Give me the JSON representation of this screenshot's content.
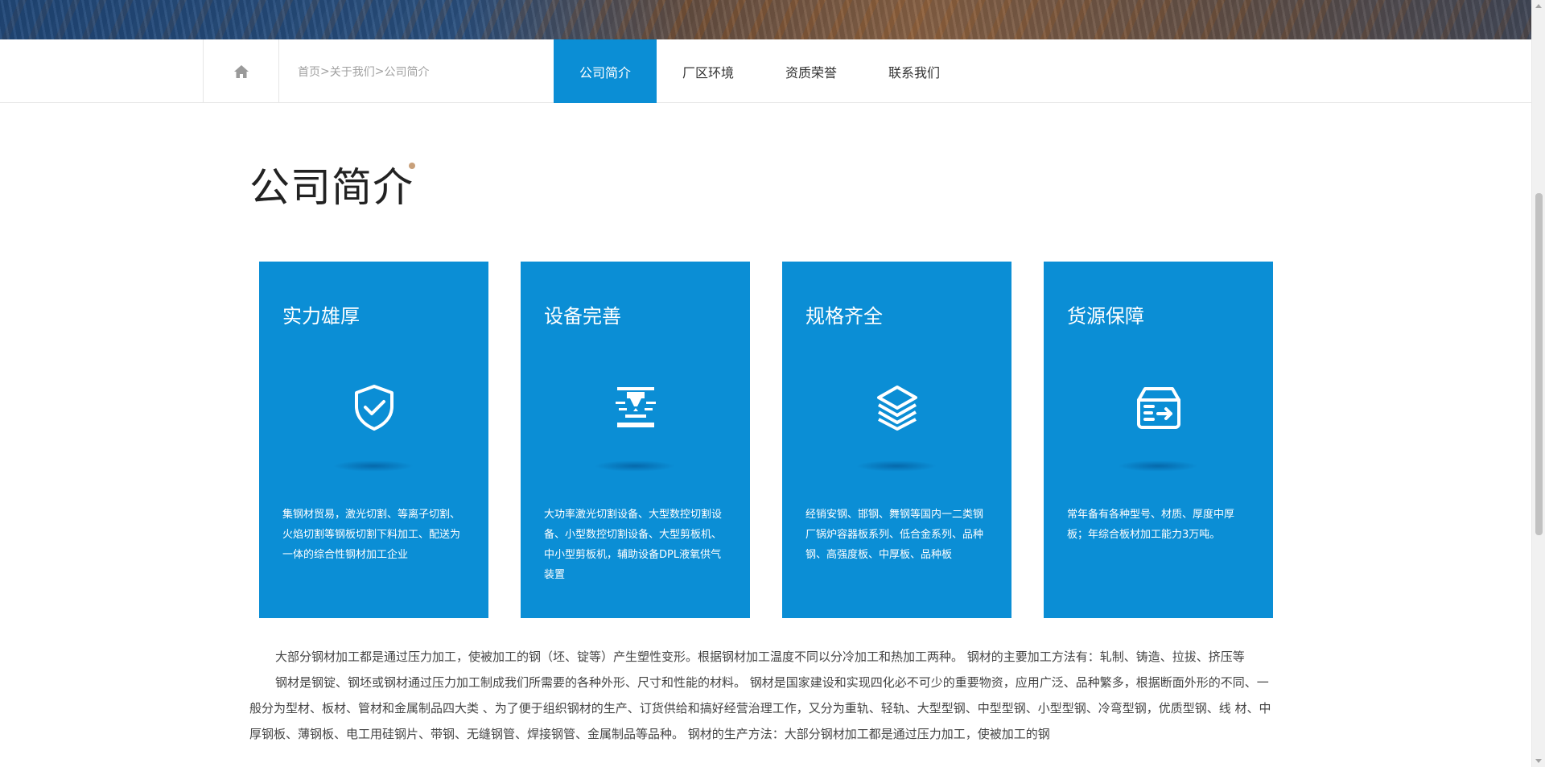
{
  "nav": {
    "home_icon": "home-icon",
    "breadcrumb": [
      "首页",
      ">",
      "关于我们",
      ">",
      "公司简介"
    ],
    "tabs": [
      {
        "label": "公司简介",
        "active": true
      },
      {
        "label": "厂区环境",
        "active": false
      },
      {
        "label": "资质荣誉",
        "active": false
      },
      {
        "label": "联系我们",
        "active": false
      }
    ]
  },
  "page_title": "公司简介",
  "accent_color": "#0b8ed5",
  "cards": [
    {
      "title": "实力雄厚",
      "icon": "shield-check-icon",
      "desc": "集钢材贸易，激光切割、等离子切割、火焰切割等钢板切割下料加工、配送为一体的综合性钢材加工企业"
    },
    {
      "title": "设备完善",
      "icon": "laser-cutter-icon",
      "desc": "大功率激光切割设备、大型数控切割设备、小型数控切割设备、大型剪板机、中小型剪板机，辅助设备DPL液氧供气装置"
    },
    {
      "title": "规格齐全",
      "icon": "layers-icon",
      "desc": "经销安钢、邯钢、舞钢等国内一二类钢厂锅炉容器板系列、低合金系列、品种钢、高强度板、中厚板、品种板"
    },
    {
      "title": "货源保障",
      "icon": "inbox-arrow-icon",
      "desc": "常年备有各种型号、材质、厚度中厚板；年综合板材加工能力3万吨。"
    }
  ],
  "article": {
    "p1": "大部分钢材加工都是通过压力加工，使被加工的钢（坯、锭等）产生塑性变形。根据钢材加工温度不同以分冷加工和热加工两种。 钢材的主要加工方法有：轧制、铸造、拉拔、挤压等",
    "p2": "钢材是钢锭、钢坯或钢材通过压力加工制成我们所需要的各种外形、尺寸和性能的材料。 钢材是国家建设和实现四化必不可少的重要物资，应用广泛、品种繁多，根据断面外形的不同、一般分为型材、板材、管材和金属制品四大类 、为了便于组织钢材的生产、订货供给和搞好经营治理工作，又分为重轨、轻轨、大型型钢、中型型钢、小型型钢、冷弯型钢，优质型钢、线 材、中厚钢板、薄钢板、电工用硅钢片、带钢、无缝钢管、焊接钢管、金属制品等品种。 钢材的生产方法：大部分钢材加工都是通过压力加工，使被加工的钢"
  }
}
